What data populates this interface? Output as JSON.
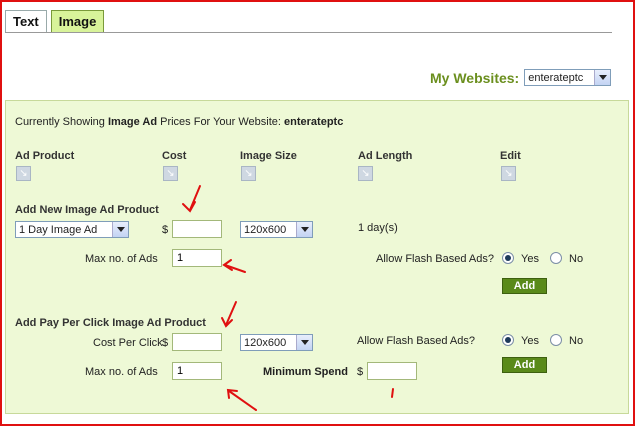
{
  "tabs": [
    {
      "label": "Text"
    },
    {
      "label": "Image"
    }
  ],
  "my_websites": {
    "label": "My Websites:",
    "selected": "enterateptc"
  },
  "panel": {
    "showing_prefix": "Currently Showing ",
    "showing_bold": "Image Ad",
    "showing_mid": " Prices For Your Website: ",
    "showing_site": "enterateptc",
    "headers": {
      "product": "Ad Product",
      "cost": "Cost",
      "size": "Image Size",
      "length": "Ad Length",
      "edit": "Edit"
    }
  },
  "image_ad": {
    "title": "Add New Image Ad Product",
    "product_select": "1 Day Image Ad",
    "currency": "$",
    "cost_value": "",
    "size_select": "120x600",
    "length_text": "1 day(s)",
    "max_ads_label": "Max no. of Ads",
    "max_ads_value": "1",
    "flash_label": "Allow Flash Based Ads?",
    "yes_label": "Yes",
    "no_label": "No",
    "add_label": "Add"
  },
  "ppc_ad": {
    "title": "Add Pay Per Click Image Ad Product",
    "cpc_label": "Cost Per Click",
    "currency": "$",
    "cpc_value": "",
    "size_select": "120x600",
    "flash_label": "Allow Flash Based Ads?",
    "yes_label": "Yes",
    "no_label": "No",
    "add_label": "Add",
    "max_ads_label": "Max no. of Ads",
    "max_ads_value": "1",
    "min_spend_label": "Minimum Spend",
    "min_spend_currency": "$",
    "min_spend_value": ""
  },
  "colors": {
    "accent": "#6b8f1e",
    "panel_bg": "#eef9d6",
    "button_bg": "#5a8a1a",
    "annotation": "#e01010"
  }
}
